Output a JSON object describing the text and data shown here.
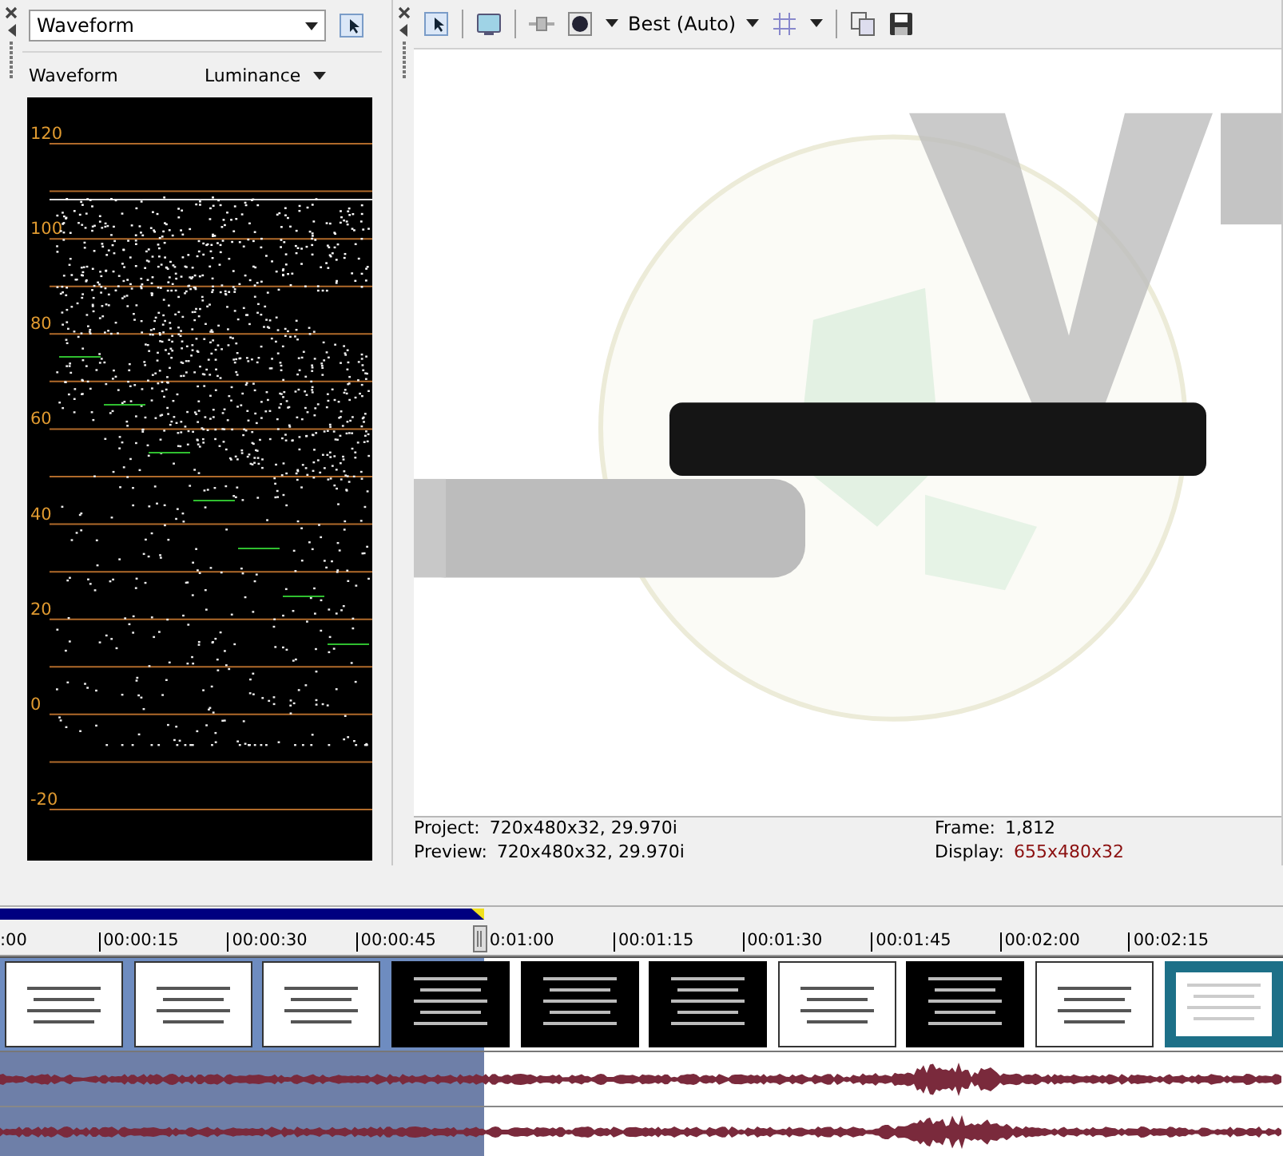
{
  "scope_panel": {
    "scope_dropdown": {
      "value": "Waveform"
    },
    "mode_label": "Waveform",
    "channel_dropdown": {
      "value": "Luminance"
    },
    "scale_labels": [
      "120",
      "100",
      "80",
      "60",
      "40",
      "20",
      "0",
      "-20"
    ]
  },
  "preview_toolbar": {
    "quality_dropdown": {
      "value": "Best (Auto)"
    }
  },
  "preview_info": [
    {
      "label": "Project:",
      "value": "720x480x32, 29.970i",
      "highlight": false
    },
    {
      "label": "Preview:",
      "value": "720x480x32, 29.970i",
      "highlight": false
    },
    {
      "label": "Frame:",
      "value": "1,812",
      "highlight": false
    },
    {
      "label": "Display:",
      "value": "655x480x32",
      "highlight": true
    }
  ],
  "timeline": {
    "ruler": [
      ":00",
      "00:00:15",
      "00:00:30",
      "00:00:45",
      "0:01:00",
      "00:01:15",
      "00:01:30",
      "00:01:45",
      "00:02:00",
      "00:02:15"
    ]
  }
}
